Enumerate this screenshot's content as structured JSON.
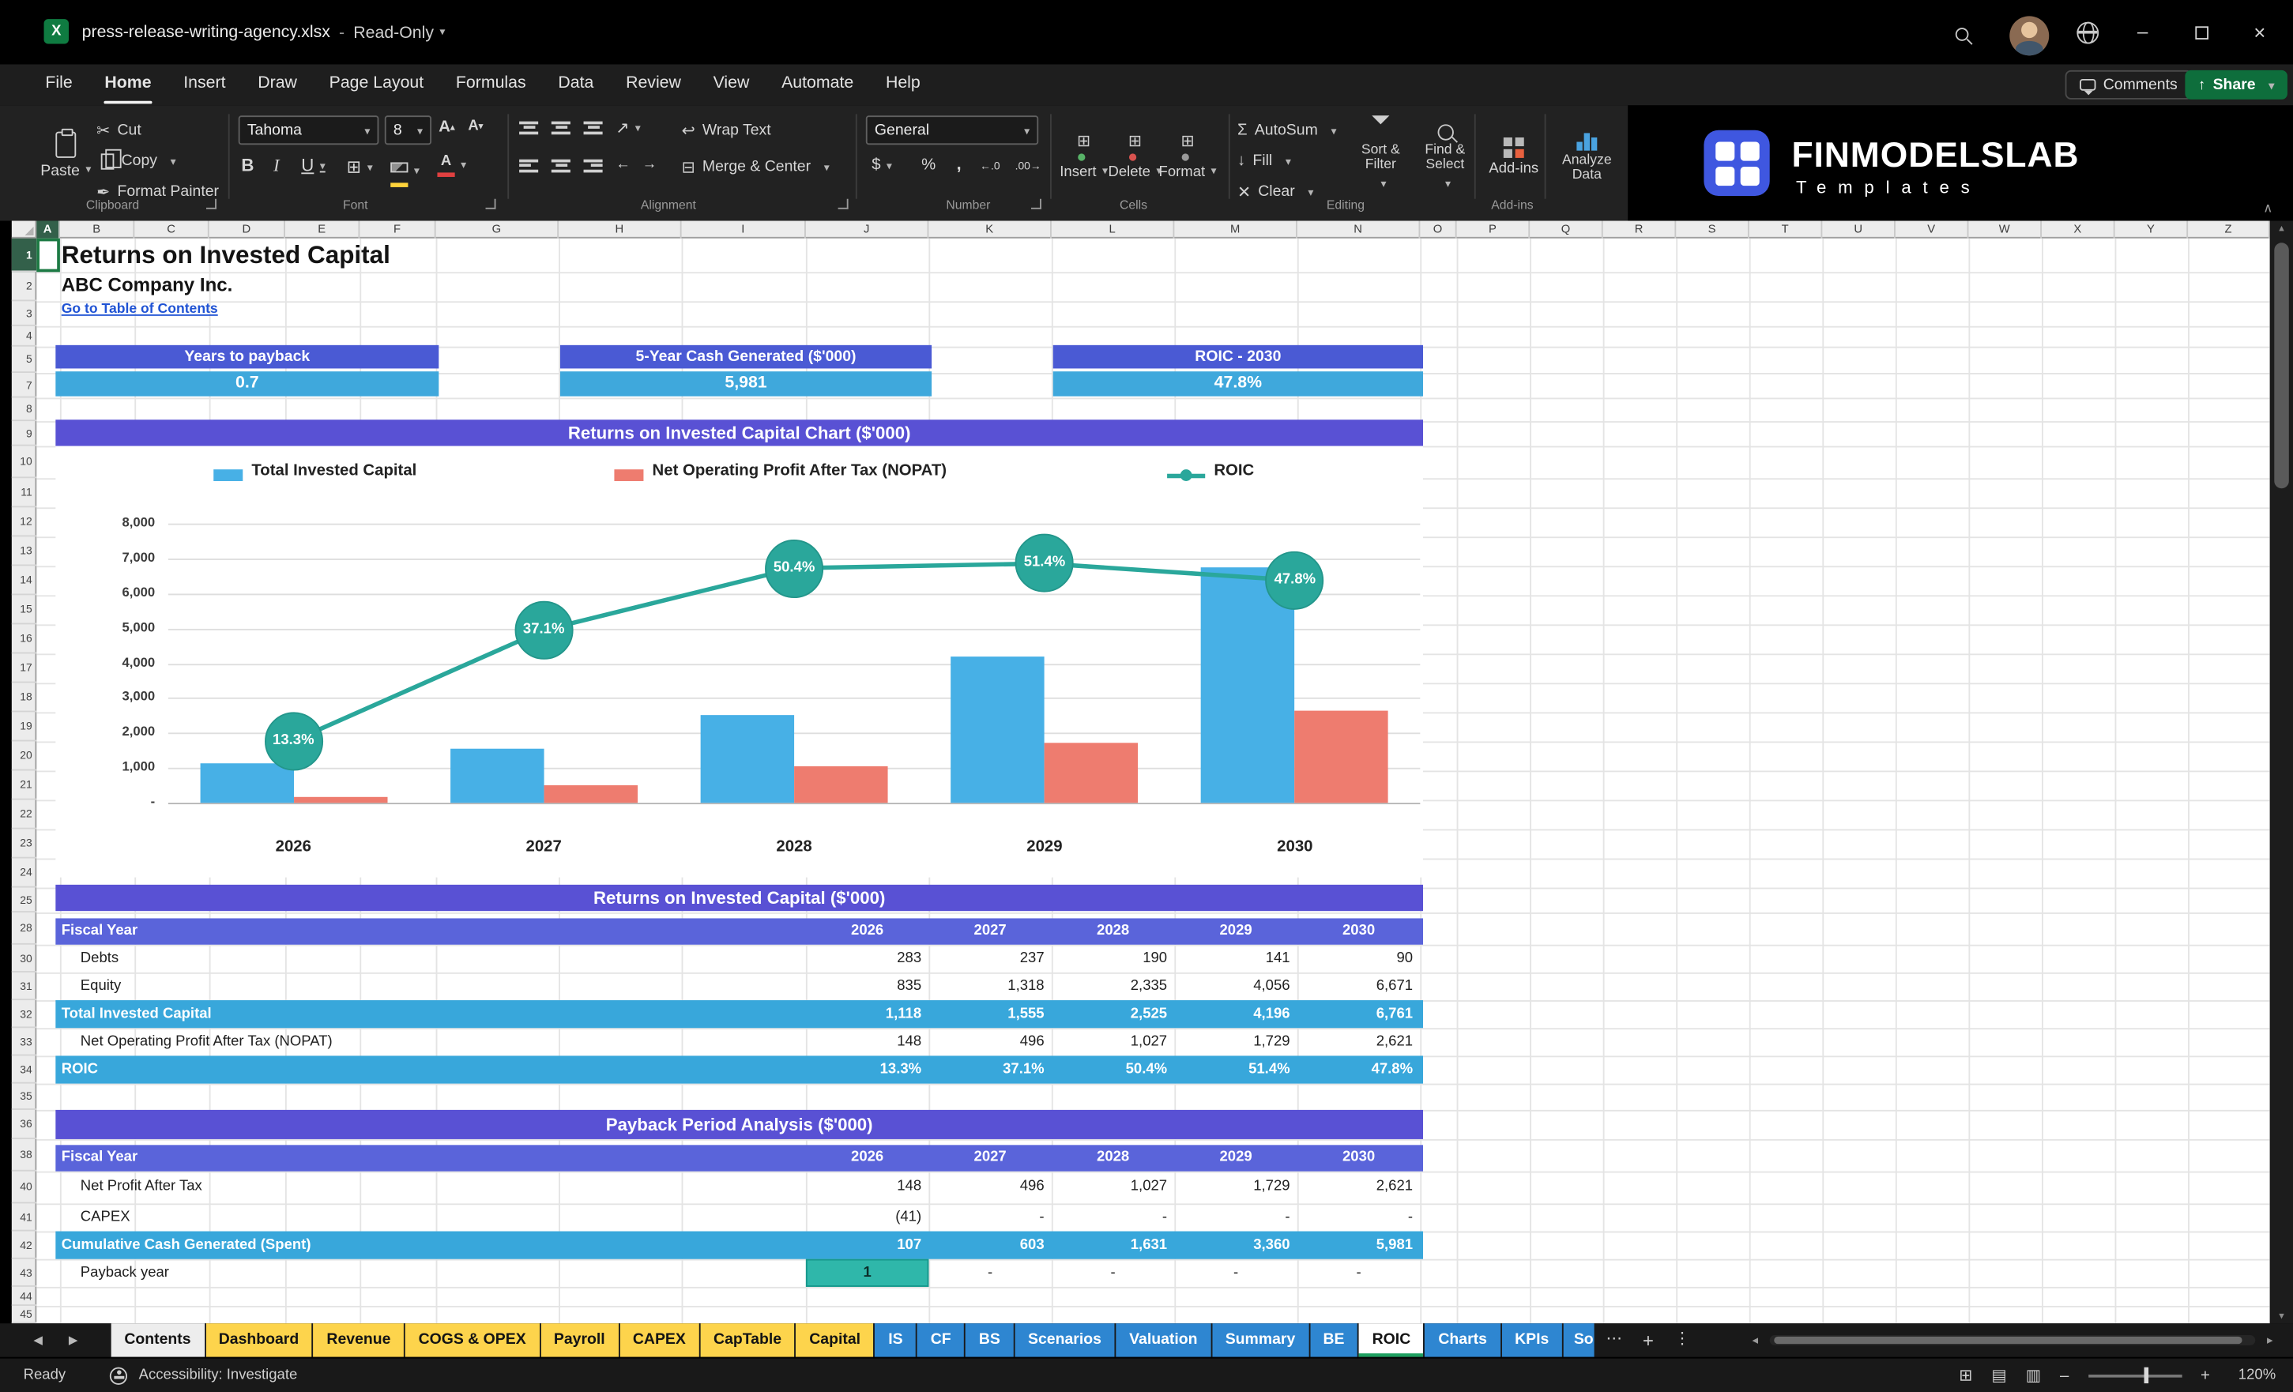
{
  "titlebar": {
    "filename": "press-release-writing-agency.xlsx",
    "separator": "-",
    "mode": "Read-Only"
  },
  "menu": {
    "items": [
      "File",
      "Home",
      "Insert",
      "Draw",
      "Page Layout",
      "Formulas",
      "Data",
      "Review",
      "View",
      "Automate",
      "Help"
    ],
    "active_index": 1,
    "comments": "Comments",
    "share": "Share"
  },
  "ribbon": {
    "paste": "Paste",
    "cut": "Cut",
    "copy": "Copy",
    "format_painter": "Format Painter",
    "group_clipboard": "Clipboard",
    "font_name": "Tahoma",
    "font_size": "8",
    "group_font": "Font",
    "wrap_text": "Wrap Text",
    "merge_center": "Merge & Center",
    "group_alignment": "Alignment",
    "number_format": "General",
    "group_number": "Number",
    "insert": "Insert",
    "delete": "Delete",
    "format": "Format",
    "group_cells": "Cells",
    "autosum": "AutoSum",
    "fill": "Fill",
    "clear": "Clear",
    "sort_filter": "Sort & Filter",
    "find_select": "Find & Select",
    "group_editing": "Editing",
    "addins": "Add-ins",
    "group_addins": "Add-ins",
    "analyze_data": "Analyze Data",
    "brand_name": "FINMODELSLAB",
    "brand_sub": "Templates"
  },
  "icons": {
    "app_letter": "X",
    "minimize": "–",
    "close": "×",
    "cut": "✂",
    "format_painter": "✒",
    "bold": "B",
    "italic": "I",
    "underline": "U",
    "borders": "⊞",
    "merge": "⊟",
    "wrap": "↩",
    "orientation": "↗",
    "currency": "$",
    "percent": "%",
    "comma": ",",
    "increase_decimal": "←.0",
    "decrease_decimal": ".00→",
    "autosum": "Σ",
    "fill": "↓",
    "clear": "✕",
    "cells_grid": "⊞",
    "collapse_ribbon": "∧",
    "prev_sheet": "◀",
    "next_sheet": "▶",
    "more_sheets": "⋯",
    "add_sheet": "+",
    "sheet_menu": "⋮",
    "view_normal": "⊞",
    "view_layout": "▤",
    "view_break": "▥",
    "zoom_out": "–",
    "zoom_in": "+",
    "scroll_up": "▴",
    "scroll_down": "▾",
    "scroll_left": "◂",
    "scroll_right": "▸"
  },
  "sheet": {
    "columns": [
      "A",
      "B",
      "C",
      "D",
      "E",
      "F",
      "G",
      "H",
      "I",
      "J",
      "K",
      "L",
      "M",
      "N",
      "O",
      "P",
      "Q",
      "R",
      "S",
      "T",
      "U",
      "V",
      "W",
      "X",
      "Y",
      "Z"
    ],
    "rows": [
      1,
      2,
      3,
      4,
      5,
      7,
      8,
      9,
      10,
      11,
      12,
      13,
      14,
      15,
      16,
      17,
      18,
      19,
      20,
      21,
      22,
      23,
      24,
      25,
      28,
      30,
      31,
      32,
      33,
      34,
      35,
      36,
      38,
      40,
      41,
      42,
      43,
      44,
      45
    ],
    "doc_title": "Returns on Invested Capital",
    "company": "ABC Company Inc.",
    "toc_link": "Go to Table of Contents",
    "kpis": [
      {
        "label": "Years to payback",
        "value": "0.7"
      },
      {
        "label": "5-Year Cash Generated ($'000)",
        "value": "5,981"
      },
      {
        "label": "ROIC - 2030",
        "value": "47.8%"
      }
    ]
  },
  "chart_data": {
    "type": "combo",
    "title": "Returns on Invested Capital Chart ($'000)",
    "categories": [
      "2026",
      "2027",
      "2028",
      "2029",
      "2030"
    ],
    "series": [
      {
        "name": "Total Invested Capital",
        "type": "bar",
        "color": "#47b0e6",
        "values": [
          1118,
          1555,
          2525,
          4196,
          6761
        ]
      },
      {
        "name": "Net Operating Profit After Tax (NOPAT)",
        "type": "bar",
        "color": "#ee7c6f",
        "values": [
          148,
          496,
          1027,
          1729,
          2621
        ]
      },
      {
        "name": "ROIC",
        "type": "line",
        "color": "#2aa79b",
        "axis": "secondary",
        "unit": "%",
        "values": [
          13.3,
          37.1,
          50.4,
          51.4,
          47.8
        ]
      }
    ],
    "y_ticks": [
      "8,000",
      "7,000",
      "6,000",
      "5,000",
      "4,000",
      "3,000",
      "2,000",
      "1,000",
      "-"
    ],
    "primary_axis": {
      "min": 0,
      "max": 8000
    },
    "secondary_axis": {
      "min": 0,
      "max": 60
    },
    "legend_position": "top",
    "grid": true
  },
  "tables": [
    {
      "title": "Returns on Invested Capital ($'000)",
      "header": [
        "Fiscal Year",
        "2026",
        "2027",
        "2028",
        "2029",
        "2030"
      ],
      "rows": [
        {
          "label": "Debts",
          "style": "plain",
          "values": [
            "283",
            "237",
            "190",
            "141",
            "90"
          ]
        },
        {
          "label": "Equity",
          "style": "plain",
          "values": [
            "835",
            "1,318",
            "2,335",
            "4,056",
            "6,671"
          ]
        },
        {
          "label": "Total Invested Capital",
          "style": "highlight",
          "values": [
            "1,118",
            "1,555",
            "2,525",
            "4,196",
            "6,761"
          ]
        },
        {
          "label": "Net Operating Profit After Tax (NOPAT)",
          "style": "plain",
          "values": [
            "148",
            "496",
            "1,027",
            "1,729",
            "2,621"
          ]
        },
        {
          "label": "ROIC",
          "style": "highlight",
          "values": [
            "13.3%",
            "37.1%",
            "50.4%",
            "51.4%",
            "47.8%"
          ]
        }
      ]
    },
    {
      "title": "Payback Period Analysis ($'000)",
      "header": [
        "Fiscal Year",
        "2026",
        "2027",
        "2028",
        "2029",
        "2030"
      ],
      "rows": [
        {
          "label": "Net Profit After Tax",
          "style": "plain",
          "values": [
            "148",
            "496",
            "1,027",
            "1,729",
            "2,621"
          ]
        },
        {
          "label": "CAPEX",
          "style": "plain",
          "values": [
            "(41)",
            "-",
            "-",
            "-",
            "-"
          ]
        },
        {
          "label": "Cumulative Cash Generated (Spent)",
          "style": "highlight",
          "values": [
            "107",
            "603",
            "1,631",
            "3,360",
            "5,981"
          ]
        },
        {
          "label": "Payback year",
          "style": "payback",
          "values": [
            "1",
            "-",
            "-",
            "-",
            "-"
          ]
        }
      ]
    }
  ],
  "sheet_tabs": [
    {
      "label": "Contents",
      "style": "light"
    },
    {
      "label": "Dashboard",
      "style": "yellow"
    },
    {
      "label": "Revenue",
      "style": "yellow"
    },
    {
      "label": "COGS & OPEX",
      "style": "yellow"
    },
    {
      "label": "Payroll",
      "style": "yellow"
    },
    {
      "label": "CAPEX",
      "style": "yellow"
    },
    {
      "label": "CapTable",
      "style": "yellow"
    },
    {
      "label": "Capital",
      "style": "yellow"
    },
    {
      "label": "IS",
      "style": "blue"
    },
    {
      "label": "CF",
      "style": "blue"
    },
    {
      "label": "BS",
      "style": "blue"
    },
    {
      "label": "Scenarios",
      "style": "blue"
    },
    {
      "label": "Valuation",
      "style": "blue"
    },
    {
      "label": "Summary",
      "style": "blue"
    },
    {
      "label": "BE",
      "style": "blue"
    },
    {
      "label": "ROIC",
      "style": "active"
    },
    {
      "label": "Charts",
      "style": "blue"
    },
    {
      "label": "KPIs",
      "style": "blue"
    },
    {
      "label": "So",
      "style": "blue-clipped"
    }
  ],
  "statusbar": {
    "ready": "Ready",
    "accessibility": "Accessibility: Investigate",
    "zoom": "120%"
  },
  "colors": {
    "kpi_header_blue": "#4a5ad4",
    "value_cyan": "#3fa8dc",
    "section_purple": "#5951d4",
    "fiscal_indigo": "#5a64da",
    "highlight_cyan": "#38a7db",
    "bar_blue": "#47b0e6",
    "bar_salmon": "#ee7c6f",
    "line_teal": "#2aa79b",
    "tab_yellow": "#fdd44c",
    "tab_blue": "#2e86d1",
    "excel_green": "#0f7b41"
  }
}
